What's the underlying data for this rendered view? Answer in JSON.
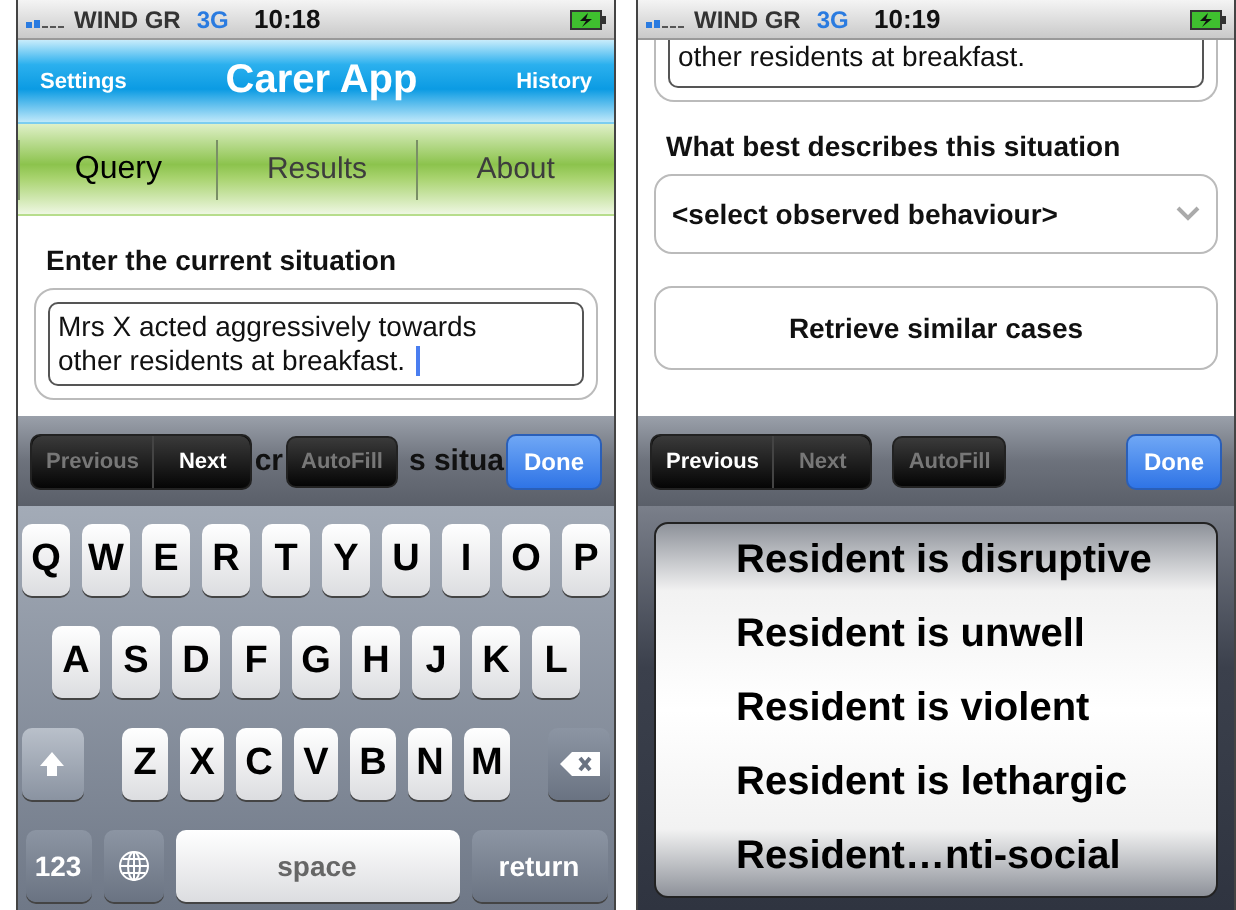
{
  "screens": [
    {
      "status_bar": {
        "carrier": "WIND GR",
        "network": "3G",
        "time": "10:18"
      },
      "nav_bar": {
        "left_button": "Settings",
        "title": "Carer App",
        "right_button": "History"
      },
      "tabs": [
        {
          "label": "Query",
          "selected": true
        },
        {
          "label": "Results",
          "selected": false
        },
        {
          "label": "About",
          "selected": false
        }
      ],
      "content": [
        {
          "kind": "heading",
          "text": "Enter the current situation"
        },
        {
          "kind": "textarea",
          "value": "Mrs X acted aggressively towards other residents at breakfast.",
          "focused": true,
          "scrolled_off_top": false
        }
      ],
      "form_toolbar": {
        "previous": {
          "label": "Previous",
          "disabled": true
        },
        "next": {
          "label": "Next",
          "disabled": false
        },
        "autofill": {
          "label": "AutoFill",
          "disabled": true
        },
        "done": "Done",
        "text_behind": [
          "cr",
          "s situa"
        ]
      },
      "keyboard": {
        "rows": [
          [
            "Q",
            "W",
            "E",
            "R",
            "T",
            "Y",
            "U",
            "I",
            "O",
            "P"
          ],
          [
            "A",
            "S",
            "D",
            "F",
            "G",
            "H",
            "J",
            "K",
            "L"
          ],
          [
            "Z",
            "X",
            "C",
            "V",
            "B",
            "N",
            "M"
          ]
        ],
        "numbers_key": "123",
        "space_key": "space",
        "return_key": "return"
      }
    },
    {
      "status_bar": {
        "carrier": "WIND GR",
        "network": "3G",
        "time": "10:19"
      },
      "content": [
        {
          "kind": "textarea",
          "value": "other residents at breakfast.",
          "focused": false,
          "scrolled_off_top": true
        },
        {
          "kind": "heading",
          "text": "What best describes this situation"
        },
        {
          "kind": "select",
          "value": "<select observed behaviour>"
        },
        {
          "kind": "button",
          "label": "Retrieve similar cases"
        }
      ],
      "form_toolbar": {
        "previous": {
          "label": "Previous",
          "disabled": false
        },
        "next": {
          "label": "Next",
          "disabled": true
        },
        "autofill": {
          "label": "AutoFill",
          "disabled": true
        },
        "done": "Done"
      },
      "picker": {
        "options": [
          "Resident is disruptive",
          "Resident is unwell",
          "Resident is violent",
          "Resident is lethargic",
          "Resident…nti-social"
        ]
      }
    }
  ]
}
